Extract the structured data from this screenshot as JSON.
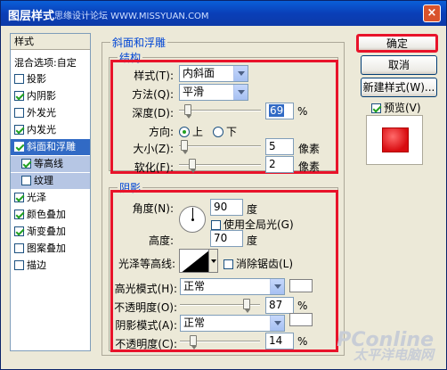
{
  "window": {
    "title": "图层样式",
    "title_watermark": "思缘设计论坛 WWW.MISSYUAN.COM",
    "close_label": "×"
  },
  "style_list": {
    "header": "样式",
    "blending": "混合选项:自定",
    "items": [
      {
        "label": "投影",
        "checked": false
      },
      {
        "label": "内阴影",
        "checked": true
      },
      {
        "label": "外发光",
        "checked": false
      },
      {
        "label": "内发光",
        "checked": true
      },
      {
        "label": "斜面和浮雕",
        "checked": true,
        "selected": true
      },
      {
        "label": "等高线",
        "checked": true,
        "sub": true
      },
      {
        "label": "纹理",
        "checked": false,
        "sub": true
      },
      {
        "label": "光泽",
        "checked": true
      },
      {
        "label": "颜色叠加",
        "checked": true
      },
      {
        "label": "渐变叠加",
        "checked": true
      },
      {
        "label": "图案叠加",
        "checked": false
      },
      {
        "label": "描边",
        "checked": false
      }
    ]
  },
  "bevel": {
    "section_title": "斜面和浮雕",
    "structure_title": "结构",
    "style_label": "样式(T):",
    "style_value": "内斜面",
    "technique_label": "方法(Q):",
    "technique_value": "平滑",
    "depth_label": "深度(D):",
    "depth_value": "69",
    "depth_unit": "%",
    "depth_level": 0.069,
    "direction_label": "方向:",
    "direction_up": "上",
    "direction_down": "下",
    "direction_selected": "up",
    "size_label": "大小(Z):",
    "size_value": "5",
    "size_unit": "像素",
    "size_level": 0.02,
    "soften_label": "软化(F):",
    "soften_value": "2",
    "soften_unit": "像素",
    "soften_level": 0.125
  },
  "shading": {
    "title": "阴影",
    "angle_label": "角度(N):",
    "angle_value": "90",
    "angle_unit": "度",
    "global_light_label": "使用全局光(G)",
    "global_light_checked": false,
    "altitude_label": "高度:",
    "altitude_value": "70",
    "altitude_unit": "度",
    "gloss_contour_label": "光泽等高线:",
    "anti_alias_label": "消除锯齿(L)",
    "anti_alias_checked": false,
    "highlight_mode_label": "高光模式(H):",
    "highlight_mode_value": "正常",
    "highlight_opacity_label": "不透明度(O):",
    "highlight_opacity_value": "87",
    "highlight_opacity_unit": "%",
    "highlight_opacity_level": 0.87,
    "shadow_mode_label": "阴影模式(A):",
    "shadow_mode_value": "正常",
    "shadow_opacity_label": "不透明度(C):",
    "shadow_opacity_value": "14",
    "shadow_opacity_unit": "%",
    "shadow_opacity_level": 0.14
  },
  "buttons": {
    "ok": "确定",
    "cancel": "取消",
    "new_style": "新建样式(W)...",
    "preview_label": "预览(V)",
    "preview_checked": true
  },
  "watermark": {
    "brand": "PConline",
    "sub": "太平洋电脑网"
  },
  "colors": {
    "highlight_box": "#e8132a",
    "preview_fill": "#d80c10",
    "group_label": "#0046d5"
  }
}
